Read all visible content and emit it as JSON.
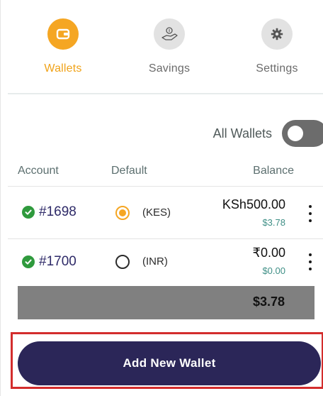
{
  "tabs": [
    {
      "label": "Wallets",
      "icon": "wallet-icon",
      "active": true
    },
    {
      "label": "Savings",
      "icon": "savings-icon",
      "active": false
    },
    {
      "label": "Settings",
      "icon": "gear-icon",
      "active": false
    }
  ],
  "toggle": {
    "label": "All Wallets",
    "on": false
  },
  "table": {
    "headers": {
      "account": "Account",
      "default": "Default",
      "balance": "Balance"
    },
    "rows": [
      {
        "account": "#1698",
        "verified": true,
        "default": true,
        "currency": "(KES)",
        "balance": "KSh500.00",
        "usd": "$3.78"
      },
      {
        "account": "#1700",
        "verified": true,
        "default": false,
        "currency": "(INR)",
        "balance": "₹0.00",
        "usd": "$0.00"
      }
    ],
    "total": "$3.78"
  },
  "actions": {
    "add_wallet": "Add New Wallet"
  },
  "colors": {
    "accent": "#f5a623",
    "primary": "#2b2658",
    "verified": "#2f9a3d",
    "highlight_border": "#d32d2d"
  }
}
